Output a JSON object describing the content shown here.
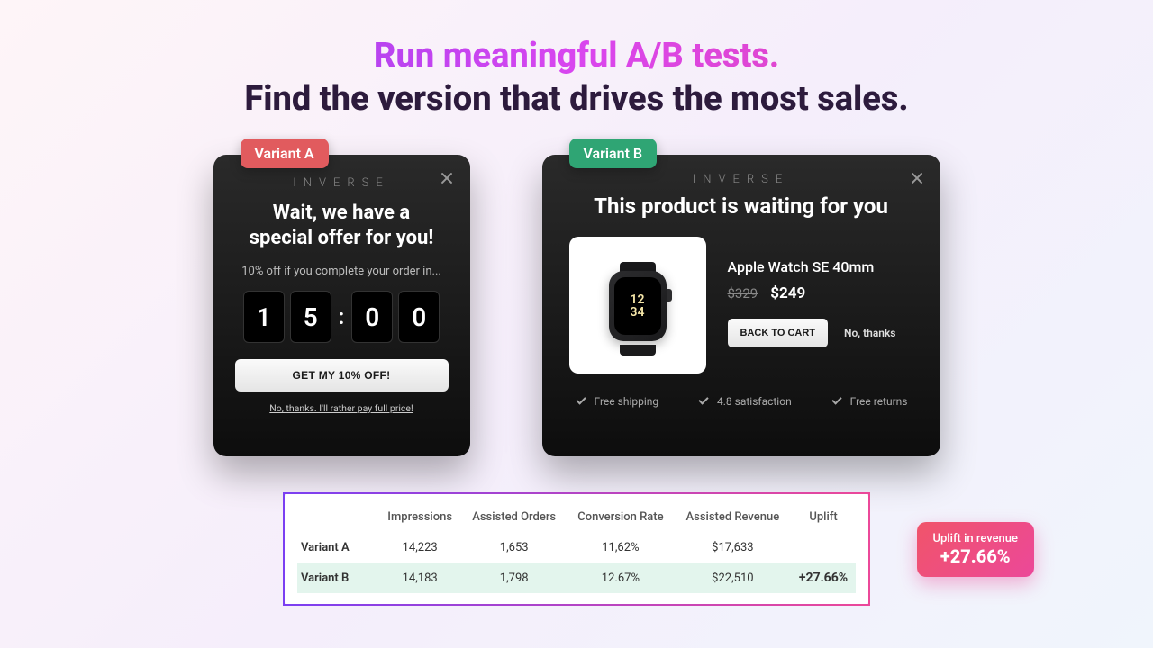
{
  "headline": {
    "top": "Run meaningful A/B tests.",
    "bottom": "Find the version that drives the most sales."
  },
  "variantA": {
    "badge": "Variant A",
    "brand": "INVERSE",
    "title_line1": "Wait, we have a",
    "title_line2": "special offer for you!",
    "subtext": "10% off if you complete your order in...",
    "timer": {
      "d1": "1",
      "d2": "5",
      "d3": "0",
      "d4": "0"
    },
    "cta": "GET MY 10% OFF!",
    "decline": "No, thanks. I'll rather pay full price!"
  },
  "variantB": {
    "badge": "Variant B",
    "brand": "INVERSE",
    "title": "This product is waiting for you",
    "product_name": "Apple Watch SE 40mm",
    "price_old": "$329",
    "price_new": "$249",
    "cta": "BACK TO CART",
    "decline": "No, thanks",
    "benefits": [
      "Free shipping",
      "4.8 satisfaction",
      "Free returns"
    ]
  },
  "stats": {
    "headers": [
      "",
      "Impressions",
      "Assisted Orders",
      "Conversion Rate",
      "Assisted Revenue",
      "Uplift"
    ],
    "rows": [
      {
        "label": "Variant A",
        "impressions": "14,223",
        "orders": "1,653",
        "cr": "11,62%",
        "revenue": "$17,633",
        "uplift": ""
      },
      {
        "label": "Variant B",
        "impressions": "14,183",
        "orders": "1,798",
        "cr": "12.67%",
        "revenue": "$22,510",
        "uplift": "+27.66%"
      }
    ]
  },
  "upliftBadge": {
    "label": "Uplift in revenue",
    "value": "+27.66%"
  }
}
